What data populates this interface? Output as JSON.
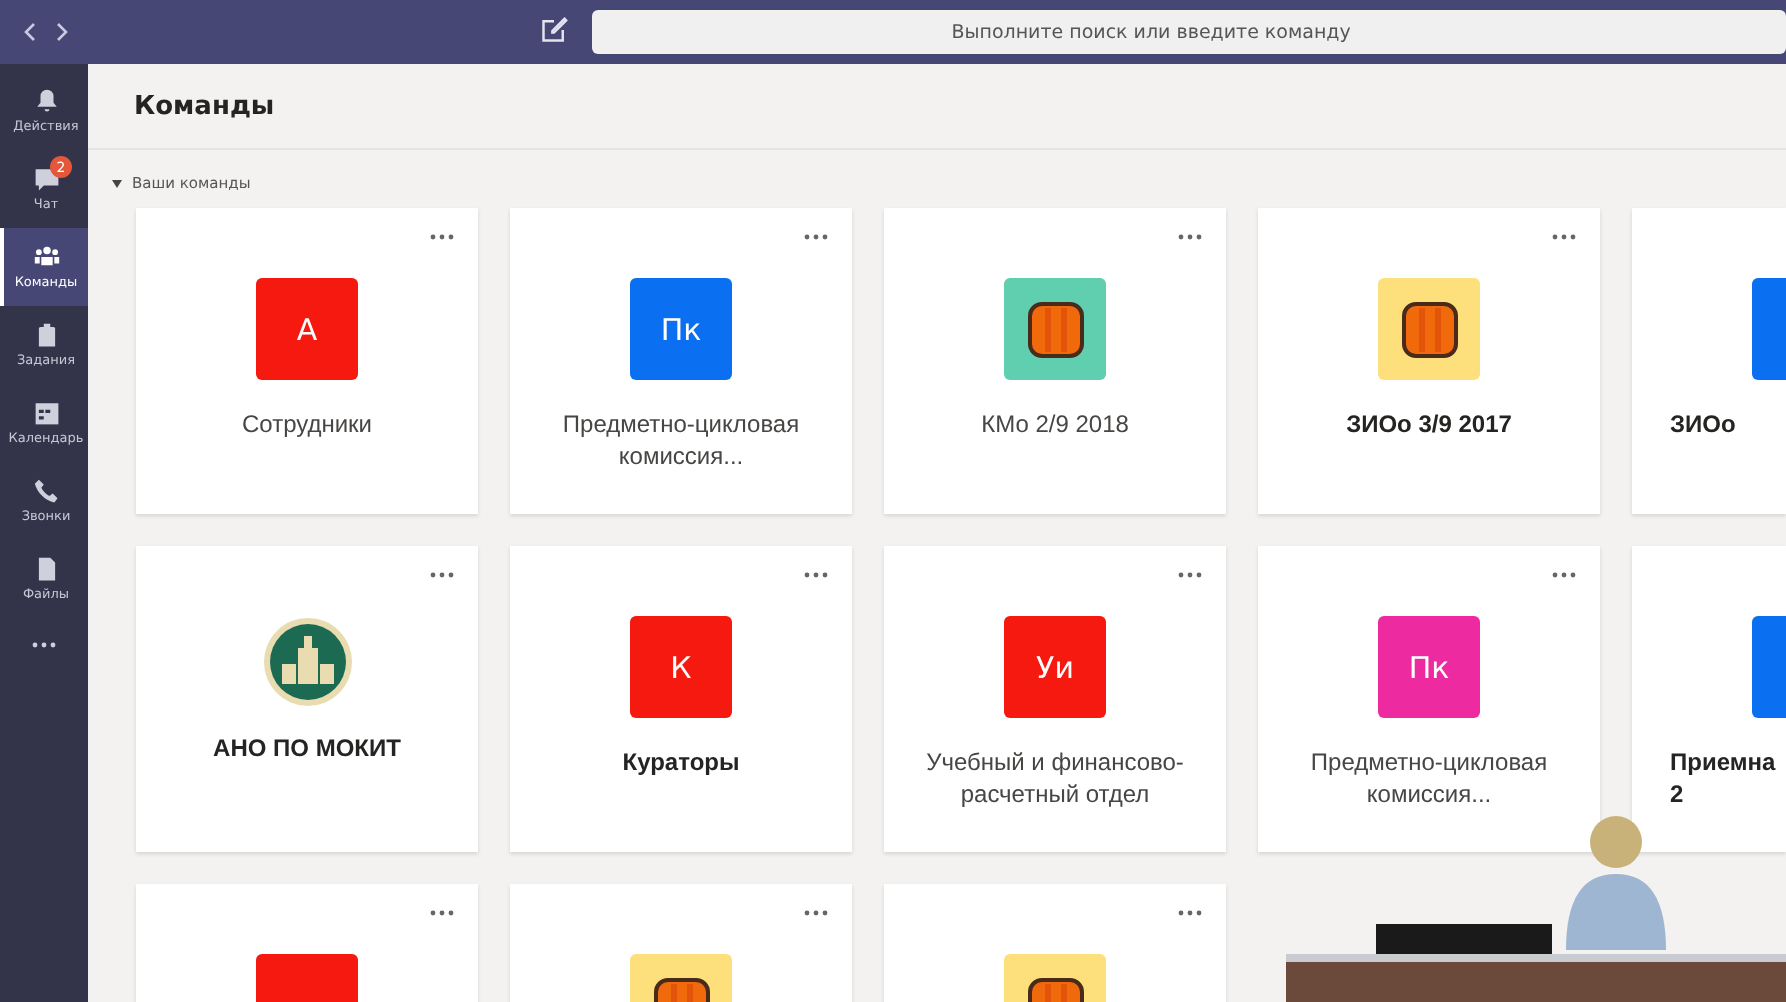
{
  "search": {
    "placeholder": "Выполните поиск или введите команду"
  },
  "sidebar": {
    "items": [
      {
        "kind": "bell",
        "label": "Действия",
        "selected": false
      },
      {
        "kind": "chat",
        "label": "Чат",
        "selected": false,
        "badge": "2"
      },
      {
        "kind": "teams",
        "label": "Команды",
        "selected": true
      },
      {
        "kind": "bag",
        "label": "Задания",
        "selected": false
      },
      {
        "kind": "calendar",
        "label": "Календарь",
        "selected": false
      },
      {
        "kind": "phone",
        "label": "Звонки",
        "selected": false
      },
      {
        "kind": "file",
        "label": "Файлы",
        "selected": false
      }
    ]
  },
  "page": {
    "title": "Команды",
    "section": "Ваши команды"
  },
  "cards": [
    {
      "avatar": {
        "kind": "initials",
        "text": "А",
        "color": "#f5190f"
      },
      "name_lines": [
        "Сотрудники"
      ],
      "bold": false
    },
    {
      "avatar": {
        "kind": "initials",
        "text": "Пк",
        "color": "#0b6ff2"
      },
      "name_lines": [
        "Предметно-цикловая",
        "комиссия..."
      ],
      "bold": false
    },
    {
      "avatar": {
        "kind": "image",
        "color": "#5fcfb0"
      },
      "name_lines": [
        "КМо 2/9 2018"
      ],
      "bold": false
    },
    {
      "avatar": {
        "kind": "image",
        "color": "#fde07c"
      },
      "name_lines": [
        "ЗИОо 3/9 2017"
      ],
      "bold": true
    },
    {
      "partial": true,
      "avatar": {
        "kind": "initials",
        "color": "#0b6ff2"
      },
      "name_lines": [
        "ЗИОо"
      ],
      "bold": true
    },
    {
      "avatar": {
        "kind": "logo",
        "color": "#1c6a52"
      },
      "name_lines": [
        "АНО ПО МОКИТ"
      ],
      "bold": true
    },
    {
      "avatar": {
        "kind": "initials",
        "text": "К",
        "color": "#f5190f"
      },
      "name_lines": [
        "Кураторы"
      ],
      "bold": true
    },
    {
      "avatar": {
        "kind": "initials",
        "text": "Уи",
        "color": "#f5190f"
      },
      "name_lines": [
        "Учебный и финансово-",
        "расчетный отдел"
      ],
      "bold": false
    },
    {
      "avatar": {
        "kind": "initials",
        "text": "Пк",
        "color": "#ee2aa0"
      },
      "name_lines": [
        "Предметно-цикловая",
        "комиссия..."
      ],
      "bold": false
    },
    {
      "partial": true,
      "avatar": {
        "kind": "initials",
        "color": "#0b6ff2"
      },
      "name_lines": [
        "Приемна",
        "2"
      ],
      "bold": true
    },
    {
      "avatar": {
        "kind": "initials",
        "color": "#f5190f"
      }
    },
    {
      "avatar": {
        "kind": "image",
        "color": "#fde07c"
      }
    },
    {
      "avatar": {
        "kind": "image",
        "color": "#fde07c"
      }
    }
  ]
}
